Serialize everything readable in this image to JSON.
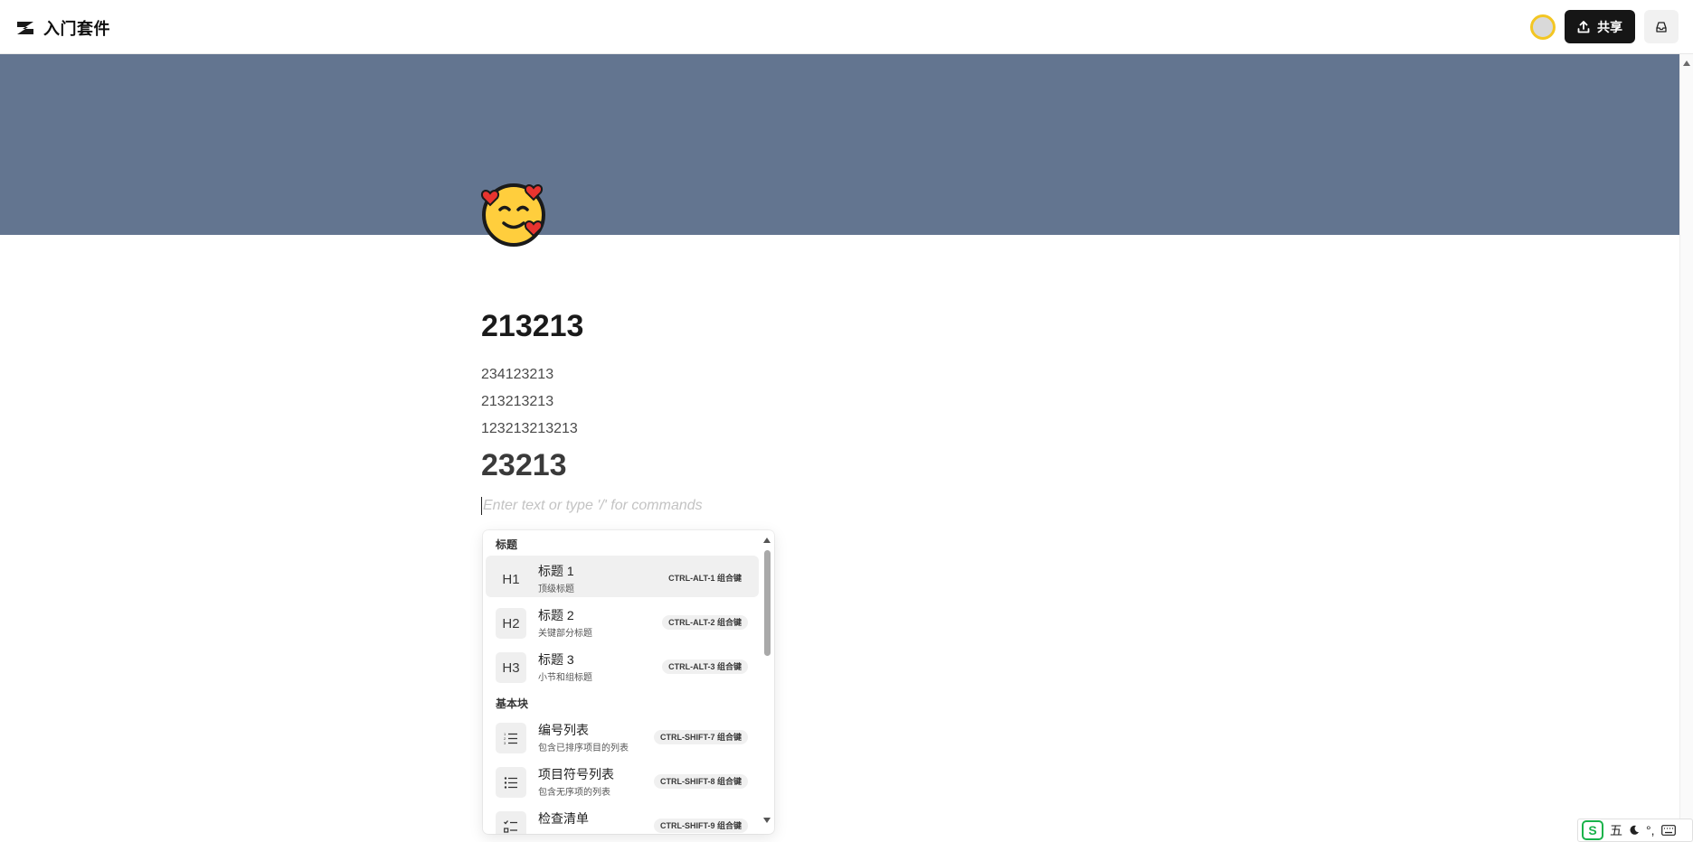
{
  "header": {
    "title": "入门套件",
    "share_label": "共享"
  },
  "cover": {
    "color": "#637590"
  },
  "page": {
    "emoji": "smiling-face-with-hearts",
    "title": "213213",
    "paragraphs": [
      "234123213",
      "213213213",
      "123213213213"
    ],
    "heading2": "23213",
    "placeholder": "Enter text or type '/' for commands"
  },
  "slash_menu": {
    "sections": [
      {
        "label": "标题"
      },
      {
        "label": "基本块"
      }
    ],
    "items": [
      {
        "icon": "H1",
        "title": "标题 1",
        "subtitle": "顶级标题",
        "shortcut": "CTRL-ALT-1 组合键",
        "active": true
      },
      {
        "icon": "H2",
        "title": "标题 2",
        "subtitle": "关键部分标题",
        "shortcut": "CTRL-ALT-2 组合键"
      },
      {
        "icon": "H3",
        "title": "标题 3",
        "subtitle": "小节和组标题",
        "shortcut": "CTRL-ALT-3 组合键"
      },
      {
        "icon": "numbered-list-icon",
        "title": "编号列表",
        "subtitle": "包含已排序项目的列表",
        "shortcut": "CTRL-SHIFT-7 组合键"
      },
      {
        "icon": "bulleted-list-icon",
        "title": "项目符号列表",
        "subtitle": "包含无序项的列表",
        "shortcut": "CTRL-SHIFT-8 组合键"
      },
      {
        "icon": "checklist-icon",
        "title": "检查清单",
        "subtitle": "",
        "shortcut": "CTRL-SHIFT-9 组合键"
      }
    ]
  },
  "ime": {
    "mode": "五",
    "symbols": "°,"
  },
  "colors": {
    "accent": "#161616",
    "avatar_ring": "#f3c623",
    "ime_green": "#19b24a"
  }
}
